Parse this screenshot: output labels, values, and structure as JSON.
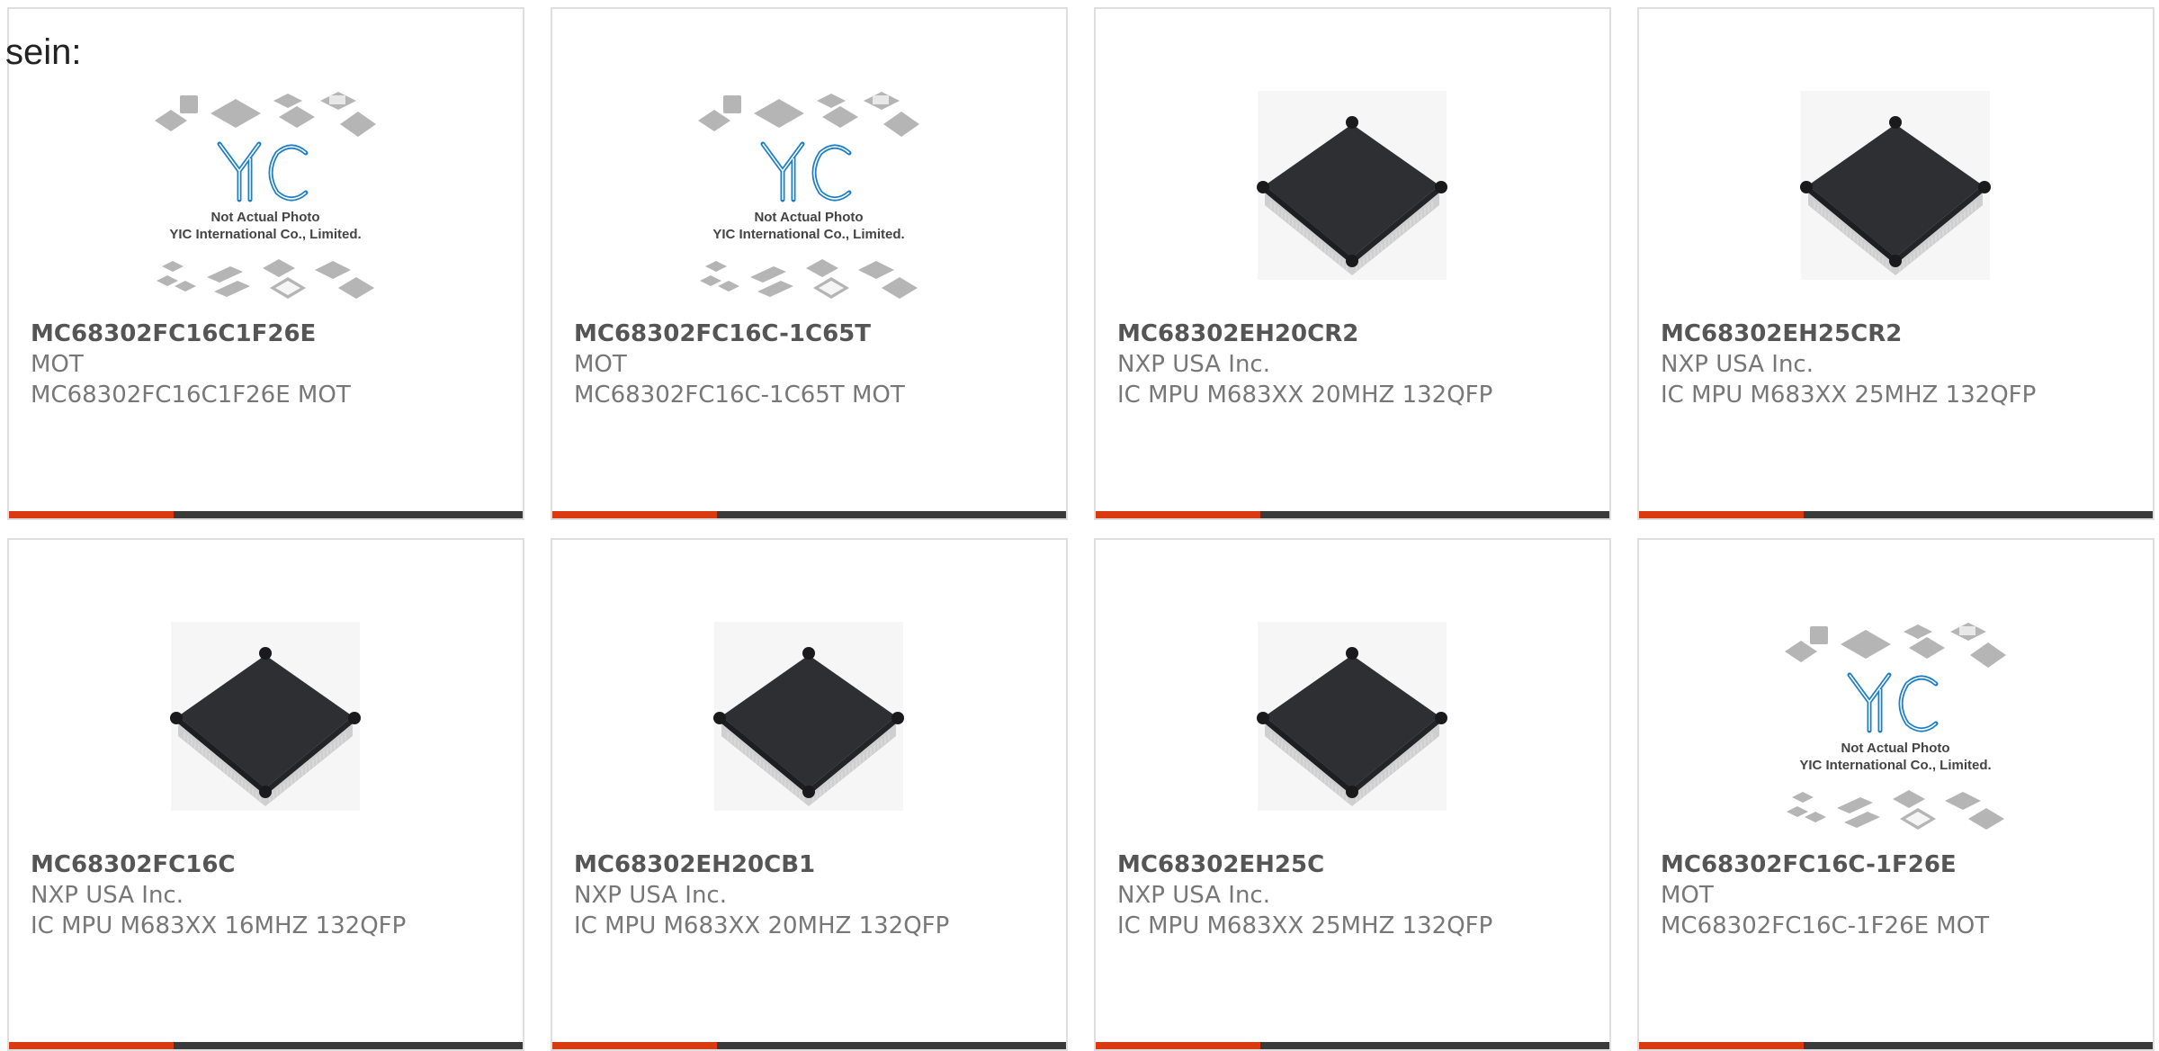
{
  "intro_text": "sein:",
  "placeholder": {
    "logo_text": "YIC",
    "line1": "Not Actual Photo",
    "line2": "YIC International Co., Limited."
  },
  "products": [
    {
      "part": "MC68302FC16C1F26E",
      "maker": "MOT",
      "desc": "MC68302FC16C1F26E MOT",
      "image": "placeholder"
    },
    {
      "part": "MC68302FC16C-1C65T",
      "maker": "MOT",
      "desc": "MC68302FC16C-1C65T MOT",
      "image": "placeholder"
    },
    {
      "part": "MC68302EH20CR2",
      "maker": "NXP USA Inc.",
      "desc": "IC MPU M683XX 20MHZ 132QFP",
      "image": "chip"
    },
    {
      "part": "MC68302EH25CR2",
      "maker": "NXP USA Inc.",
      "desc": "IC MPU M683XX 25MHZ 132QFP",
      "image": "chip"
    },
    {
      "part": "MC68302FC16C",
      "maker": "NXP USA Inc.",
      "desc": "IC MPU M683XX 16MHZ 132QFP",
      "image": "chip"
    },
    {
      "part": "MC68302EH20CB1",
      "maker": "NXP USA Inc.",
      "desc": "IC MPU M683XX 20MHZ 132QFP",
      "image": "chip"
    },
    {
      "part": "MC68302EH25C",
      "maker": "NXP USA Inc.",
      "desc": "IC MPU M683XX 25MHZ 132QFP",
      "image": "chip"
    },
    {
      "part": "MC68302FC16C-1F26E",
      "maker": "MOT",
      "desc": "MC68302FC16C-1F26E MOT",
      "image": "placeholder"
    }
  ],
  "colors": {
    "accent": "#d93a10",
    "bar": "#3a3a3a",
    "text": "#777777",
    "part_number": "#555555"
  }
}
